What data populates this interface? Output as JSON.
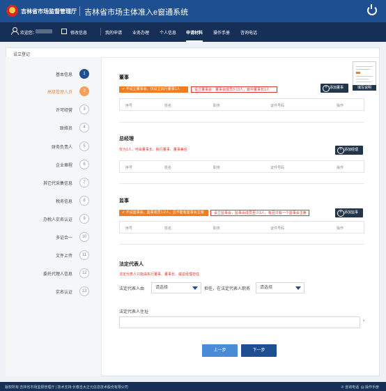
{
  "header": {
    "org_name": "吉林省市场监督管理厅",
    "system_title": "吉林省市场主体准入e窗通系统"
  },
  "nav": {
    "welcome": "欢迎您：",
    "edit_info": "修改信息",
    "items": [
      "我的申请",
      "业务办理",
      "个人信息",
      "申请材料",
      "操作手册",
      "咨询电话"
    ],
    "active": "申请材料"
  },
  "page": {
    "title": "设立登记"
  },
  "steps": [
    {
      "label": "基本信息",
      "num": "1",
      "state": "done"
    },
    {
      "label": "高级管理人员",
      "num": "2",
      "state": "current"
    },
    {
      "label": "许可经营",
      "num": "3",
      "state": "todo"
    },
    {
      "label": "联络员",
      "num": "4",
      "state": "todo"
    },
    {
      "label": "财务负责人",
      "num": "5",
      "state": "todo"
    },
    {
      "label": "企业章程",
      "num": "6",
      "state": "todo"
    },
    {
      "label": "其它代采集信息",
      "num": "7",
      "state": "todo"
    },
    {
      "label": "税务信息",
      "num": "8",
      "state": "todo"
    },
    {
      "label": "办税人实名认证",
      "num": "9",
      "state": "todo"
    },
    {
      "label": "多证合一",
      "num": "10",
      "state": "todo"
    },
    {
      "label": "文件上传",
      "num": "11",
      "state": "todo"
    },
    {
      "label": "委托代理人信息",
      "num": "12",
      "state": "todo"
    },
    {
      "label": "实名认证",
      "num": "13",
      "state": "todo"
    }
  ],
  "table_headers": [
    "序号",
    "姓名",
    "职务",
    "证件号码",
    "操作"
  ],
  "directors": {
    "title": "董事",
    "rule_selected": "✔ 不设立董事会，仅设立执行董事1人",
    "rule_option": "设立董事会：董事会成员3-13人，其中董事长1人",
    "add_button": "添加董事"
  },
  "manager": {
    "title": "总经理",
    "note": "仅为1人，可由董事长、执行董事、董事兼任",
    "add_button": "添加经理"
  },
  "supervisors": {
    "title": "监事",
    "rule_selected": "✔ 不设监事会，监事成员1-2人，且不能有监事会主席",
    "rule_option": "设立监事会，监事会成员至少3人，有且只有一个监事会主席",
    "add_button": "添加监事"
  },
  "legal_rep": {
    "title": "法定代表人",
    "note": "法定代表人只能由执行董事、董事长、或总经理担任",
    "from_label": "法定代表人由",
    "acts_label": "担任，在法定代表人职务",
    "select_placeholder": "请选择",
    "address_label": "法定代表人住址",
    "required_mark": "*"
  },
  "buttons": {
    "prev": "上一步",
    "next": "下一步"
  },
  "thumbnail": {
    "button": "填写说明"
  },
  "footer": {
    "left": "版权所有:吉林省市场监督管理厅 | 技术支持:长春吉大正元信息技术股份有限公司",
    "right_help": "咨询电话",
    "right_manual": "操作手册"
  },
  "colors": {
    "header_blue": "#1d4f91",
    "nav_dark": "#152f57",
    "accent_orange": "#f27c1f",
    "warning_red": "#e0332e"
  }
}
